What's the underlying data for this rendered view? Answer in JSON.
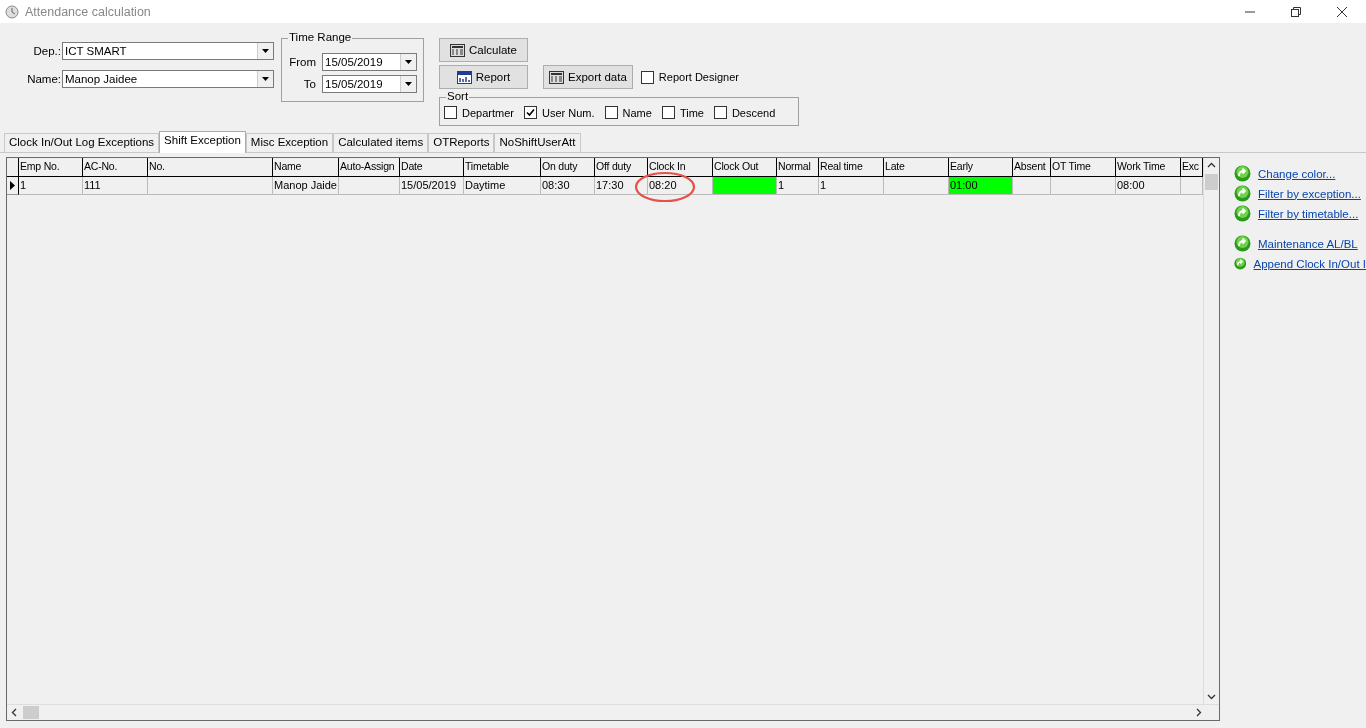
{
  "window": {
    "title": "Attendance calculation"
  },
  "filters": {
    "department_label": "Dep.:",
    "department": "ICT SMART",
    "name_label": "Name:",
    "name": "Manop Jaidee"
  },
  "time_range": {
    "title": "Time Range",
    "from_label": "From",
    "from": "15/05/2019",
    "to_label": "To",
    "to": "15/05/2019"
  },
  "buttons": [
    {
      "label": "Calculate",
      "kind": "calc"
    },
    {
      "label": "Report",
      "kind": "report"
    },
    {
      "label": "Export data",
      "kind": "calc"
    }
  ],
  "report_designer": {
    "label": "Report Designer",
    "checked": false
  },
  "sort": {
    "title": "Sort",
    "options": [
      {
        "label": "Departmer",
        "checked": false
      },
      {
        "label": "User Num.",
        "checked": true
      },
      {
        "label": "Name",
        "checked": false
      },
      {
        "label": "Time",
        "checked": false
      },
      {
        "label": "Descend",
        "checked": false
      }
    ]
  },
  "tabs": [
    {
      "label": "Clock In/Out Log Exceptions",
      "selected": false
    },
    {
      "label": "Shift Exception",
      "selected": true
    },
    {
      "label": "Misc Exception",
      "selected": false
    },
    {
      "label": "Calculated items",
      "selected": false
    },
    {
      "label": "OTReports",
      "selected": false
    },
    {
      "label": "NoShiftUserAtt",
      "selected": false
    }
  ],
  "table": {
    "columns": [
      "Emp No.",
      "AC-No.",
      "No.",
      "Name",
      "Auto-Assign",
      "Date",
      "Timetable",
      "On duty",
      "Off duty",
      "Clock In",
      "Clock Out",
      "Normal",
      "Real time",
      "Late",
      "Early",
      "Absent",
      "OT Time",
      "Work Time",
      "Exc"
    ],
    "rows": [
      {
        "selected": true,
        "cells": [
          {
            "text": "1"
          },
          {
            "text": "111"
          },
          {},
          {
            "text": "Manop Jaide"
          },
          {},
          {
            "text": "15/05/2019"
          },
          {
            "text": "Daytime"
          },
          {
            "text": "08:30"
          },
          {
            "text": "17:30"
          },
          {
            "text": "08:20",
            "circled": true
          },
          {
            "color": "#00ff00"
          },
          {
            "text": "1"
          },
          {
            "text": "1"
          },
          {},
          {
            "text": "01:00",
            "color": "#00ff00"
          },
          {},
          {},
          {
            "text": "08:00"
          },
          {}
        ]
      }
    ]
  },
  "action_groups": [
    [
      {
        "label": "Change color..."
      },
      {
        "label": "Filter by exception..."
      },
      {
        "label": "Filter by timetable..."
      }
    ],
    [
      {
        "label": "Maintenance AL/BL"
      },
      {
        "label": "Append Clock In/Out I"
      }
    ]
  ]
}
